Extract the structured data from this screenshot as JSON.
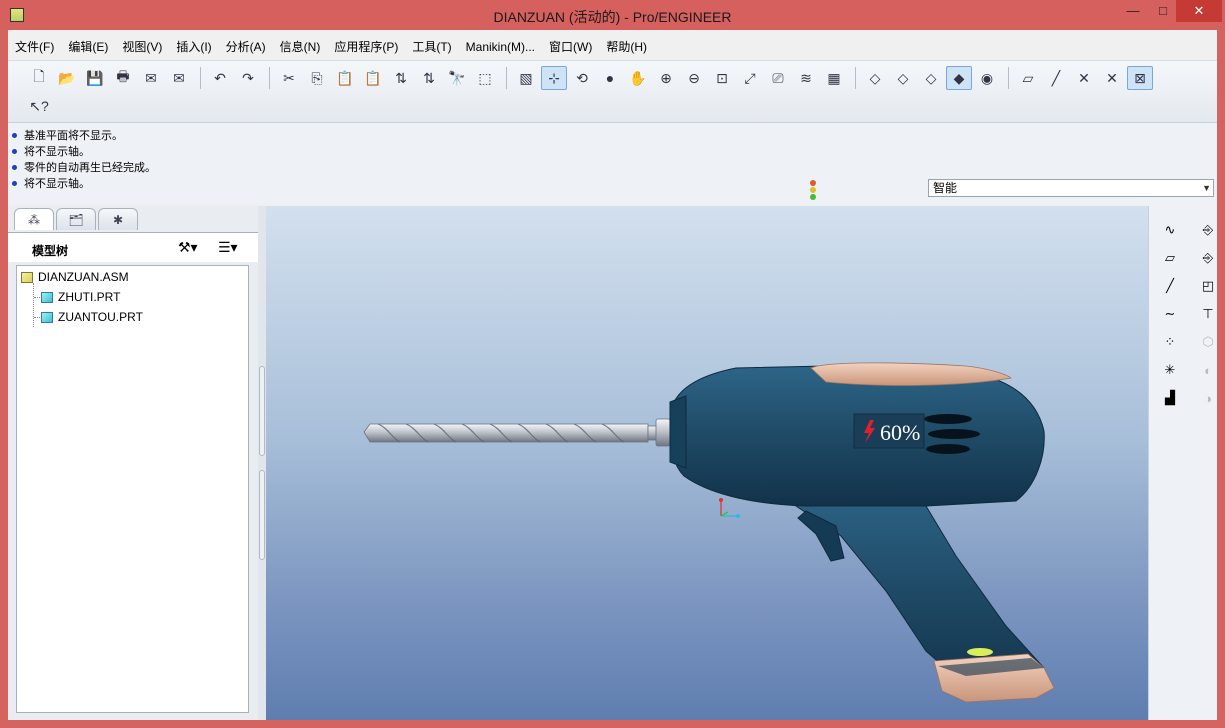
{
  "window": {
    "title": "DIANZUAN (活动的) - Pro/ENGINEER",
    "minimize": "—",
    "maximize": "□",
    "close": "✕"
  },
  "menu": [
    "文件(F)",
    "编辑(E)",
    "视图(V)",
    "插入(I)",
    "分析(A)",
    "信息(N)",
    "应用程序(P)",
    "工具(T)",
    "Manikin(M)...",
    "窗口(W)",
    "帮助(H)"
  ],
  "toolbar": {
    "row1": [
      {
        "icon": "new-icon",
        "glyph": "🗋"
      },
      {
        "icon": "open-icon",
        "glyph": "📂"
      },
      {
        "icon": "save-icon",
        "glyph": "💾"
      },
      {
        "icon": "print-icon",
        "glyph": "🖶"
      },
      {
        "icon": "email-icon",
        "glyph": "✉"
      },
      {
        "icon": "email-link-icon",
        "glyph": "✉"
      },
      {
        "sep": true
      },
      {
        "icon": "undo-icon",
        "glyph": "↶"
      },
      {
        "icon": "redo-icon",
        "glyph": "↷"
      },
      {
        "sep": true
      },
      {
        "icon": "cut-icon",
        "glyph": "✂"
      },
      {
        "icon": "copy-icon",
        "glyph": "⎘"
      },
      {
        "icon": "paste-icon",
        "glyph": "📋"
      },
      {
        "icon": "paste-special-icon",
        "glyph": "📋"
      },
      {
        "icon": "regenerate-icon",
        "glyph": "⇅"
      },
      {
        "icon": "regen-manager-icon",
        "glyph": "⇅"
      },
      {
        "icon": "find-icon",
        "glyph": "🔭"
      },
      {
        "icon": "select-box-icon",
        "glyph": "⬚"
      },
      {
        "sep": true
      },
      {
        "icon": "redraw-icon",
        "glyph": "▧",
        "active": false
      },
      {
        "icon": "spin-center-icon",
        "glyph": "⊹",
        "active": true
      },
      {
        "icon": "orient-icon",
        "glyph": "⟲"
      },
      {
        "icon": "appearance-icon",
        "glyph": "●"
      },
      {
        "icon": "pan-hand-icon",
        "glyph": "✋"
      },
      {
        "icon": "zoom-in-icon",
        "glyph": "⊕"
      },
      {
        "icon": "zoom-out-icon",
        "glyph": "⊖"
      },
      {
        "icon": "refit-icon",
        "glyph": "⊡"
      },
      {
        "icon": "reorient-icon",
        "glyph": "⤢"
      },
      {
        "icon": "saved-views-icon",
        "glyph": "⎚"
      },
      {
        "icon": "layers-icon",
        "glyph": "≋"
      },
      {
        "icon": "view-manager-icon",
        "glyph": "▦"
      },
      {
        "sep": true
      },
      {
        "icon": "wireframe-icon",
        "glyph": "◇"
      },
      {
        "icon": "hidden-line-icon",
        "glyph": "◇"
      },
      {
        "icon": "no-hidden-icon",
        "glyph": "◇"
      },
      {
        "icon": "shading-icon",
        "glyph": "◆",
        "active": true
      },
      {
        "icon": "enhanced-realism-icon",
        "glyph": "◉"
      },
      {
        "sep": true
      },
      {
        "icon": "datum-plane-display-icon",
        "glyph": "▱"
      },
      {
        "icon": "datum-axis-display-icon",
        "glyph": "╱"
      },
      {
        "icon": "datum-point-display-icon",
        "glyph": "✕"
      },
      {
        "icon": "csys-display-icon",
        "glyph": "✕"
      },
      {
        "icon": "annotation-display-icon",
        "glyph": "⊠",
        "active": true
      }
    ],
    "row2": [
      {
        "icon": "context-help-icon",
        "glyph": "↖?"
      }
    ]
  },
  "messages": [
    "基准平面将不显示。",
    "将不显示轴。",
    "零件的自动再生已经完成。",
    "将不显示轴。"
  ],
  "filter": {
    "selected": "智能",
    "arrow": "▼"
  },
  "tabs": [
    {
      "icon": "model-tree-tab-icon",
      "glyph": "⁂"
    },
    {
      "icon": "folder-browser-tab-icon",
      "glyph": "🗂"
    },
    {
      "icon": "favorites-tab-icon",
      "glyph": "✱"
    }
  ],
  "model_tree": {
    "title": "模型树",
    "settings_glyph": "⚒▾",
    "show_glyph": "☰▾",
    "items": [
      {
        "label": "DIANZUAN.ASM",
        "type": "asm"
      },
      {
        "label": "ZHUTI.PRT",
        "type": "prt"
      },
      {
        "label": "ZUANTOU.PRT",
        "type": "prt"
      }
    ]
  },
  "model": {
    "battery_label": "60%",
    "battery_level": 0.6,
    "colors": {
      "body": "#1f4a66",
      "accent": "#e3b49a",
      "bit": "#d0d4da",
      "background_top": "#d3e0ee",
      "background_bottom": "#5f7db0"
    }
  },
  "right_toolbar": [
    {
      "icon": "sketch-icon",
      "glyph": "∿",
      "col": 0,
      "row": 0
    },
    {
      "icon": "datum-plane-icon",
      "glyph": "▱",
      "col": 0,
      "row": 1
    },
    {
      "icon": "datum-axis-icon",
      "glyph": "╱",
      "col": 0,
      "row": 2
    },
    {
      "icon": "datum-curve-icon",
      "glyph": "∼",
      "col": 0,
      "row": 3
    },
    {
      "icon": "datum-point-icon",
      "glyph": "⁘",
      "col": 0,
      "row": 4
    },
    {
      "icon": "csys-icon",
      "glyph": "✳",
      "col": 0,
      "row": 5
    },
    {
      "icon": "analysis-feature-icon",
      "glyph": "▟",
      "col": 0,
      "row": 6
    },
    {
      "icon": "assemble-component-icon",
      "glyph": "⎆",
      "col": 1,
      "row": 0
    },
    {
      "icon": "create-component-icon",
      "glyph": "⎆",
      "col": 1,
      "row": 1
    },
    {
      "icon": "package-component-icon",
      "glyph": "◰",
      "col": 1,
      "row": 2
    },
    {
      "icon": "shape-icon",
      "glyph": "⊤",
      "col": 1,
      "row": 3
    },
    {
      "icon": "extrude-icon",
      "glyph": "⬡",
      "col": 1,
      "row": 4
    },
    {
      "icon": "revolve-icon",
      "glyph": "◐",
      "col": 1,
      "row": 5
    },
    {
      "icon": "sweep-icon",
      "glyph": "◑",
      "col": 1,
      "row": 6
    }
  ]
}
